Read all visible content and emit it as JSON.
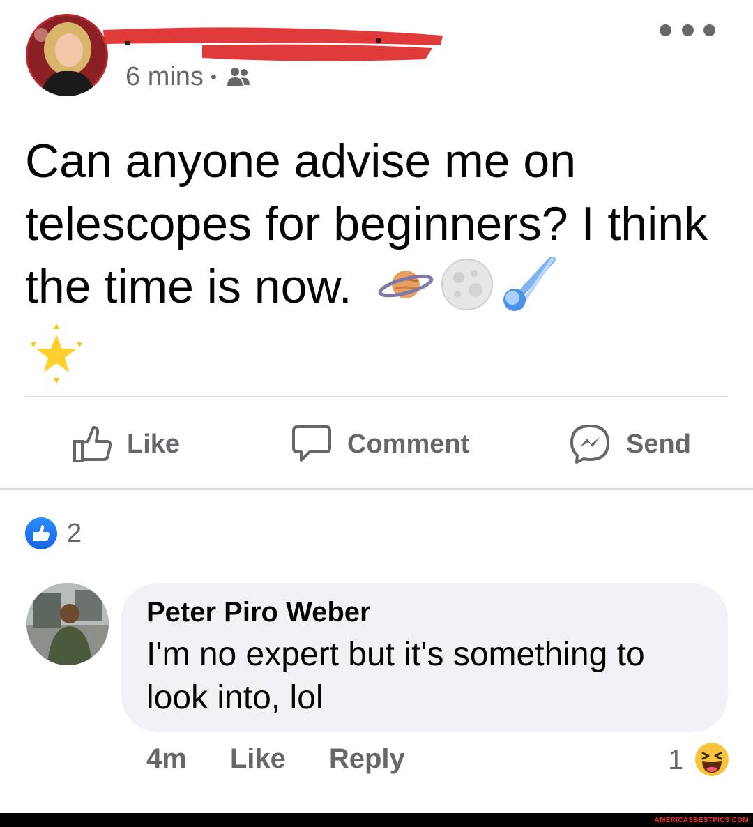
{
  "post": {
    "time": "6 mins",
    "separator": "•",
    "audience_icon": "friends-icon",
    "text": "Can anyone advise me on telescopes for beginners? I think the time is now.",
    "emojis": [
      "ringed-planet",
      "full-moon",
      "comet",
      "sparkles-star"
    ]
  },
  "actions": {
    "like_label": "Like",
    "comment_label": "Comment",
    "send_label": "Send"
  },
  "reactions": {
    "count": "2",
    "icon": "like-reaction-icon"
  },
  "comment": {
    "author": "Peter Piro Weber",
    "text": "I'm no expert but it's something to look into, lol",
    "time": "4m",
    "like_label": "Like",
    "reply_label": "Reply",
    "reaction_count": "1",
    "reaction_icon": "haha-reaction-icon"
  },
  "footer": {
    "brand": "AMERICASBESTPICS.COM"
  },
  "colors": {
    "secondary_text": "#65676b",
    "bubble": "#f0f2f5",
    "like_blue": "#1877f2",
    "redaction": "#e03a3a"
  }
}
